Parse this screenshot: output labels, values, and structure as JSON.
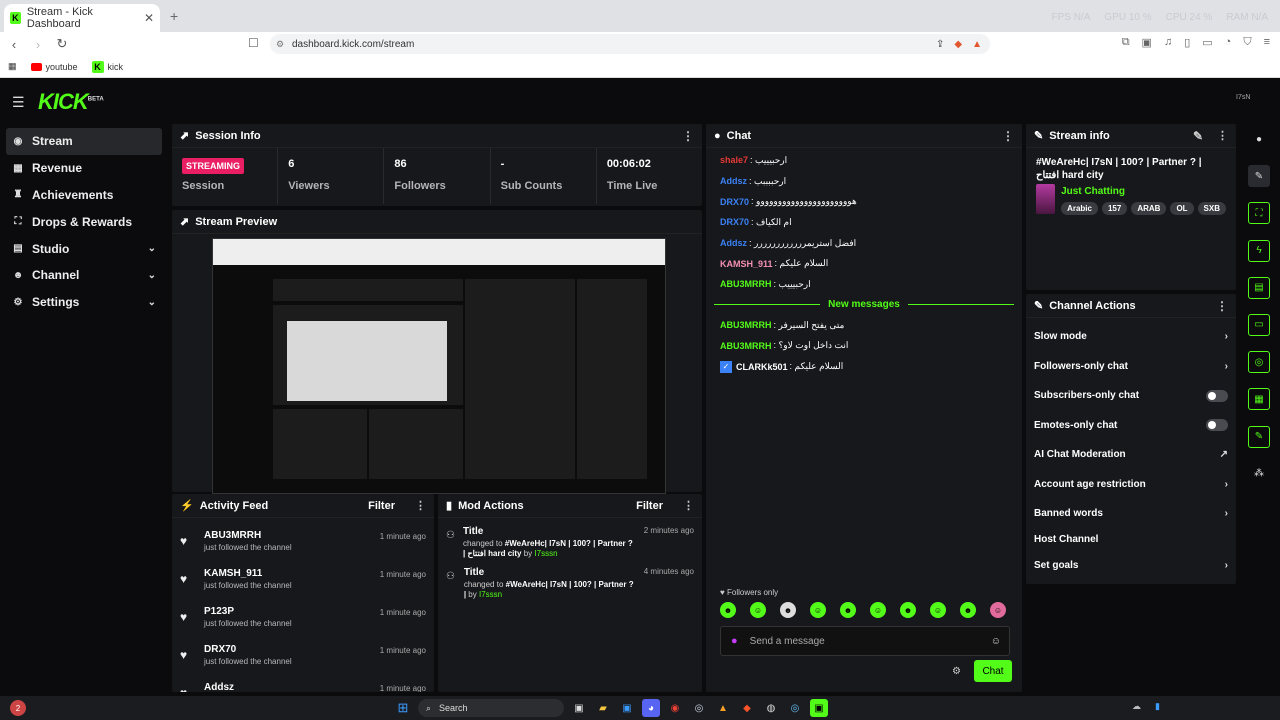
{
  "browser": {
    "tab_title": "Stream - Kick Dashboard",
    "url": "dashboard.kick.com/stream",
    "bookmarks": [
      "youtube",
      "kick"
    ],
    "system": [
      "FPS N/A",
      "GPU 10 %",
      "CPU 24 %",
      "RAM N/A"
    ]
  },
  "app": {
    "logo": "KICK",
    "logo_sup": "BETA",
    "corner_badge": "I7sN"
  },
  "sidebar": {
    "items": [
      {
        "label": "Stream",
        "icon": "stream-icon"
      },
      {
        "label": "Revenue",
        "icon": "revenue-icon"
      },
      {
        "label": "Achievements",
        "icon": "trophy-icon"
      },
      {
        "label": "Drops & Rewards",
        "icon": "gift-icon"
      },
      {
        "label": "Studio",
        "icon": "studio-icon"
      },
      {
        "label": "Channel",
        "icon": "channel-icon"
      },
      {
        "label": "Settings",
        "icon": "gear-icon"
      }
    ]
  },
  "session": {
    "title": "Session Info",
    "status": "STREAMING",
    "status_label": "Session",
    "viewers": "6",
    "viewers_label": "Viewers",
    "followers": "86",
    "followers_label": "Followers",
    "subs": "-",
    "subs_label": "Sub Counts",
    "time": "00:06:02",
    "time_label": "Time Live"
  },
  "preview": {
    "title": "Stream Preview"
  },
  "activity": {
    "title": "Activity Feed",
    "filter": "Filter",
    "items": [
      {
        "name": "ABU3MRRH",
        "sub": "just followed the channel",
        "time": "1 minute ago"
      },
      {
        "name": "KAMSH_911",
        "sub": "just followed the channel",
        "time": "1 minute ago"
      },
      {
        "name": "P123P",
        "sub": "just followed the channel",
        "time": "1 minute ago"
      },
      {
        "name": "DRX70",
        "sub": "just followed the channel",
        "time": "1 minute ago"
      },
      {
        "name": "Addsz",
        "sub": "",
        "time": "1 minute ago"
      }
    ]
  },
  "mod": {
    "title": "Mod Actions",
    "filter": "Filter",
    "items": [
      {
        "title": "Title",
        "prefix": "changed to",
        "value": "#WeAreHc| I7sN | 100? | Partner ? | افتتاح hard city",
        "by_label": "by",
        "by": "I7sssn",
        "time": "2 minutes ago"
      },
      {
        "title": "Title",
        "prefix": "changed to",
        "value": "#WeAreHc| I7sN | 100? | Partner ? |",
        "by_label": "by",
        "by": "I7sssn",
        "time": "4 minutes ago"
      }
    ]
  },
  "chat": {
    "title": "Chat",
    "messages": [
      {
        "user": "shale7",
        "text": ": ارحبيييب",
        "color": "#e53935"
      },
      {
        "user": "Addsz",
        "text": ": ارحببببب",
        "color": "#3b82f6"
      },
      {
        "user": "DRX70",
        "text": ": هوووووووووووووووووووووو",
        "color": "#3b82f6"
      },
      {
        "user": "DRX70",
        "text": ": ام الكياف",
        "color": "#3b82f6"
      },
      {
        "user": "Addsz",
        "text": ": افضل استريمرررررررررررر",
        "color": "#3b82f6"
      },
      {
        "user": "KAMSH_911",
        "text": ": السلام عليكم",
        "color": "#f48fb1"
      },
      {
        "user": "ABU3MRRH",
        "text": ": ارحبيييب",
        "color": "#53fc18"
      }
    ],
    "new_messages": "New messages",
    "new": [
      {
        "user": "ABU3MRRH",
        "text": ": متى يفتح السيرفر",
        "color": "#53fc18"
      },
      {
        "user": "ABU3MRRH",
        "text": ": انت داخل اوت لاو؟",
        "color": "#53fc18"
      },
      {
        "user": "CLARKk501",
        "text": ": السلام عليكم",
        "color": "#ffffff"
      }
    ],
    "followers_only": "Followers only",
    "placeholder": "Send a message",
    "send": "Chat"
  },
  "stream_info": {
    "title": "Stream info",
    "stream_title": "#WeAreHc| I7sN | 100? | Partner ? | افتتاح hard city",
    "category": "Just Chatting",
    "tags": [
      "Arabic",
      "157",
      "ARAB",
      "OL",
      "SXB"
    ]
  },
  "channel_actions": {
    "title": "Channel Actions",
    "items": [
      {
        "label": "Slow mode",
        "ctl": "chevron"
      },
      {
        "label": "Followers-only chat",
        "ctl": "chevron"
      },
      {
        "label": "Subscribers-only chat",
        "ctl": "toggle"
      },
      {
        "label": "Emotes-only chat",
        "ctl": "toggle"
      },
      {
        "label": "AI Chat Moderation",
        "ctl": "external"
      },
      {
        "label": "Account age restriction",
        "ctl": "chevron"
      },
      {
        "label": "Banned words",
        "ctl": "chevron"
      },
      {
        "label": "Host Channel",
        "ctl": "none"
      },
      {
        "label": "Set goals",
        "ctl": "chevron"
      }
    ]
  },
  "taskbar": {
    "search": "Search"
  }
}
